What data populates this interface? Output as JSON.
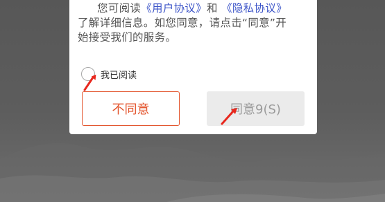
{
  "dialog": {
    "intro_prefix": "您可阅读",
    "user_agreement_link": "《用户协议》",
    "conjunction": "和",
    "privacy_policy_link": "《隐私协议》",
    "line2": "了解详细信息。如您同意，请点击“同意”开",
    "line3": "始接受我们的服务。",
    "checkbox_label": "我已阅读",
    "disagree_button": "不同意",
    "agree_button": "同意9(S)"
  },
  "colors": {
    "link": "#3d55c8",
    "disagree_accent": "#e3542c",
    "agree_disabled_bg": "#ebebeb",
    "agree_disabled_text": "#9b9b9b",
    "annotation_arrow": "#e8281e",
    "backdrop": "#5a5a5a"
  },
  "annotations": {
    "arrow_icons": [
      "red-arrow-icon",
      "red-arrow-icon"
    ]
  }
}
